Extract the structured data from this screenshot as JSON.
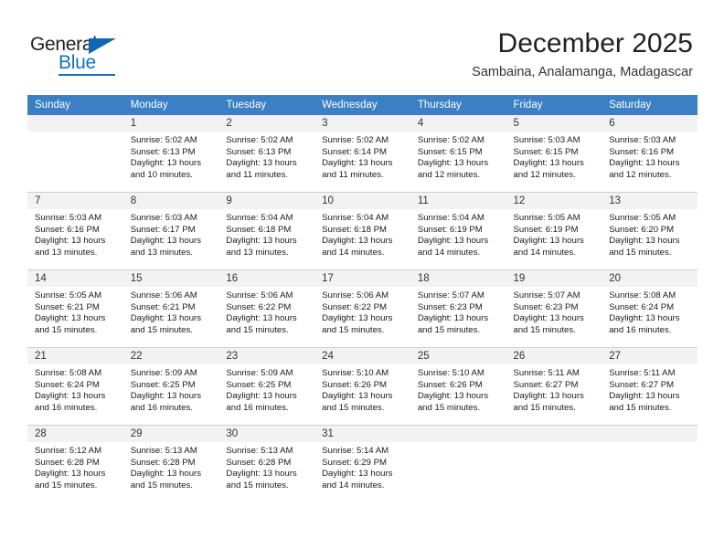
{
  "brand": {
    "name_part1": "General",
    "name_part2": "Blue",
    "accent_color": "#1373ba",
    "triangle_color": "#0a67b2"
  },
  "header": {
    "month_title": "December 2025",
    "location": "Sambaina, Analamanga, Madagascar"
  },
  "calendar": {
    "header_bg": "#3b7fc4",
    "daynum_bg": "#f2f2f2",
    "weekday_headers": [
      "Sunday",
      "Monday",
      "Tuesday",
      "Wednesday",
      "Thursday",
      "Friday",
      "Saturday"
    ],
    "weeks": [
      [
        {
          "day": "",
          "empty": true,
          "sunrise": "",
          "sunset": "",
          "daylight1": "",
          "daylight2": ""
        },
        {
          "day": "1",
          "sunrise": "Sunrise: 5:02 AM",
          "sunset": "Sunset: 6:13 PM",
          "daylight1": "Daylight: 13 hours",
          "daylight2": "and 10 minutes."
        },
        {
          "day": "2",
          "sunrise": "Sunrise: 5:02 AM",
          "sunset": "Sunset: 6:13 PM",
          "daylight1": "Daylight: 13 hours",
          "daylight2": "and 11 minutes."
        },
        {
          "day": "3",
          "sunrise": "Sunrise: 5:02 AM",
          "sunset": "Sunset: 6:14 PM",
          "daylight1": "Daylight: 13 hours",
          "daylight2": "and 11 minutes."
        },
        {
          "day": "4",
          "sunrise": "Sunrise: 5:02 AM",
          "sunset": "Sunset: 6:15 PM",
          "daylight1": "Daylight: 13 hours",
          "daylight2": "and 12 minutes."
        },
        {
          "day": "5",
          "sunrise": "Sunrise: 5:03 AM",
          "sunset": "Sunset: 6:15 PM",
          "daylight1": "Daylight: 13 hours",
          "daylight2": "and 12 minutes."
        },
        {
          "day": "6",
          "sunrise": "Sunrise: 5:03 AM",
          "sunset": "Sunset: 6:16 PM",
          "daylight1": "Daylight: 13 hours",
          "daylight2": "and 12 minutes."
        }
      ],
      [
        {
          "day": "7",
          "sunrise": "Sunrise: 5:03 AM",
          "sunset": "Sunset: 6:16 PM",
          "daylight1": "Daylight: 13 hours",
          "daylight2": "and 13 minutes."
        },
        {
          "day": "8",
          "sunrise": "Sunrise: 5:03 AM",
          "sunset": "Sunset: 6:17 PM",
          "daylight1": "Daylight: 13 hours",
          "daylight2": "and 13 minutes."
        },
        {
          "day": "9",
          "sunrise": "Sunrise: 5:04 AM",
          "sunset": "Sunset: 6:18 PM",
          "daylight1": "Daylight: 13 hours",
          "daylight2": "and 13 minutes."
        },
        {
          "day": "10",
          "sunrise": "Sunrise: 5:04 AM",
          "sunset": "Sunset: 6:18 PM",
          "daylight1": "Daylight: 13 hours",
          "daylight2": "and 14 minutes."
        },
        {
          "day": "11",
          "sunrise": "Sunrise: 5:04 AM",
          "sunset": "Sunset: 6:19 PM",
          "daylight1": "Daylight: 13 hours",
          "daylight2": "and 14 minutes."
        },
        {
          "day": "12",
          "sunrise": "Sunrise: 5:05 AM",
          "sunset": "Sunset: 6:19 PM",
          "daylight1": "Daylight: 13 hours",
          "daylight2": "and 14 minutes."
        },
        {
          "day": "13",
          "sunrise": "Sunrise: 5:05 AM",
          "sunset": "Sunset: 6:20 PM",
          "daylight1": "Daylight: 13 hours",
          "daylight2": "and 15 minutes."
        }
      ],
      [
        {
          "day": "14",
          "sunrise": "Sunrise: 5:05 AM",
          "sunset": "Sunset: 6:21 PM",
          "daylight1": "Daylight: 13 hours",
          "daylight2": "and 15 minutes."
        },
        {
          "day": "15",
          "sunrise": "Sunrise: 5:06 AM",
          "sunset": "Sunset: 6:21 PM",
          "daylight1": "Daylight: 13 hours",
          "daylight2": "and 15 minutes."
        },
        {
          "day": "16",
          "sunrise": "Sunrise: 5:06 AM",
          "sunset": "Sunset: 6:22 PM",
          "daylight1": "Daylight: 13 hours",
          "daylight2": "and 15 minutes."
        },
        {
          "day": "17",
          "sunrise": "Sunrise: 5:06 AM",
          "sunset": "Sunset: 6:22 PM",
          "daylight1": "Daylight: 13 hours",
          "daylight2": "and 15 minutes."
        },
        {
          "day": "18",
          "sunrise": "Sunrise: 5:07 AM",
          "sunset": "Sunset: 6:23 PM",
          "daylight1": "Daylight: 13 hours",
          "daylight2": "and 15 minutes."
        },
        {
          "day": "19",
          "sunrise": "Sunrise: 5:07 AM",
          "sunset": "Sunset: 6:23 PM",
          "daylight1": "Daylight: 13 hours",
          "daylight2": "and 15 minutes."
        },
        {
          "day": "20",
          "sunrise": "Sunrise: 5:08 AM",
          "sunset": "Sunset: 6:24 PM",
          "daylight1": "Daylight: 13 hours",
          "daylight2": "and 16 minutes."
        }
      ],
      [
        {
          "day": "21",
          "sunrise": "Sunrise: 5:08 AM",
          "sunset": "Sunset: 6:24 PM",
          "daylight1": "Daylight: 13 hours",
          "daylight2": "and 16 minutes."
        },
        {
          "day": "22",
          "sunrise": "Sunrise: 5:09 AM",
          "sunset": "Sunset: 6:25 PM",
          "daylight1": "Daylight: 13 hours",
          "daylight2": "and 16 minutes."
        },
        {
          "day": "23",
          "sunrise": "Sunrise: 5:09 AM",
          "sunset": "Sunset: 6:25 PM",
          "daylight1": "Daylight: 13 hours",
          "daylight2": "and 16 minutes."
        },
        {
          "day": "24",
          "sunrise": "Sunrise: 5:10 AM",
          "sunset": "Sunset: 6:26 PM",
          "daylight1": "Daylight: 13 hours",
          "daylight2": "and 15 minutes."
        },
        {
          "day": "25",
          "sunrise": "Sunrise: 5:10 AM",
          "sunset": "Sunset: 6:26 PM",
          "daylight1": "Daylight: 13 hours",
          "daylight2": "and 15 minutes."
        },
        {
          "day": "26",
          "sunrise": "Sunrise: 5:11 AM",
          "sunset": "Sunset: 6:27 PM",
          "daylight1": "Daylight: 13 hours",
          "daylight2": "and 15 minutes."
        },
        {
          "day": "27",
          "sunrise": "Sunrise: 5:11 AM",
          "sunset": "Sunset: 6:27 PM",
          "daylight1": "Daylight: 13 hours",
          "daylight2": "and 15 minutes."
        }
      ],
      [
        {
          "day": "28",
          "sunrise": "Sunrise: 5:12 AM",
          "sunset": "Sunset: 6:28 PM",
          "daylight1": "Daylight: 13 hours",
          "daylight2": "and 15 minutes."
        },
        {
          "day": "29",
          "sunrise": "Sunrise: 5:13 AM",
          "sunset": "Sunset: 6:28 PM",
          "daylight1": "Daylight: 13 hours",
          "daylight2": "and 15 minutes."
        },
        {
          "day": "30",
          "sunrise": "Sunrise: 5:13 AM",
          "sunset": "Sunset: 6:28 PM",
          "daylight1": "Daylight: 13 hours",
          "daylight2": "and 15 minutes."
        },
        {
          "day": "31",
          "sunrise": "Sunrise: 5:14 AM",
          "sunset": "Sunset: 6:29 PM",
          "daylight1": "Daylight: 13 hours",
          "daylight2": "and 14 minutes."
        },
        {
          "day": "",
          "empty": true,
          "sunrise": "",
          "sunset": "",
          "daylight1": "",
          "daylight2": ""
        },
        {
          "day": "",
          "empty": true,
          "sunrise": "",
          "sunset": "",
          "daylight1": "",
          "daylight2": ""
        },
        {
          "day": "",
          "empty": true,
          "sunrise": "",
          "sunset": "",
          "daylight1": "",
          "daylight2": ""
        }
      ]
    ]
  }
}
